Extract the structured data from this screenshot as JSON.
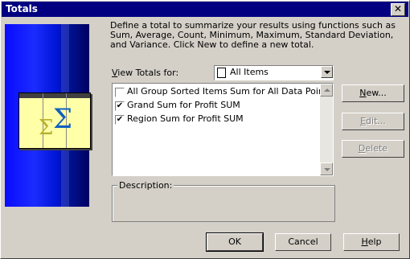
{
  "window": {
    "title": "Totals",
    "close_label": "✕"
  },
  "intro_text": "Define a total to summarize your results using functions such as Sum, Average, Count, Minimum, Maximum, Standard Deviation, and Variance. Click New to define a new total.",
  "view_totals": {
    "label_underlined": "V",
    "label_rest": "iew Totals for:",
    "selected": "All Items"
  },
  "totals_list": [
    {
      "label": "All Group Sorted Items Sum for All Data Points",
      "checked": false
    },
    {
      "label": "Grand Sum for Profit SUM",
      "checked": true
    },
    {
      "label": "Region Sum for Profit SUM",
      "checked": true
    }
  ],
  "description": {
    "label": "Description:"
  },
  "buttons": {
    "new": {
      "u": "N",
      "rest": "ew..."
    },
    "edit": {
      "u": "E",
      "rest": "dit..."
    },
    "delete": {
      "u": "D",
      "rest": "elete"
    },
    "ok": "OK",
    "cancel": "Cancel",
    "help": {
      "u": "H",
      "rest": "elp"
    }
  },
  "icons": {
    "sigma_a": "Σ",
    "sigma_b": "Σ"
  },
  "check_mark": "✔"
}
